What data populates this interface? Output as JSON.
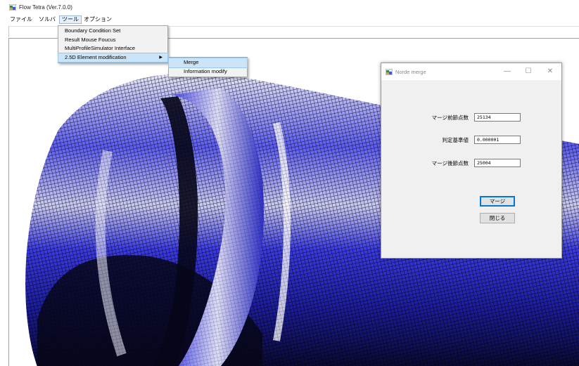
{
  "window": {
    "title": "Flow Tetra (Ver.7.0.0)",
    "icon": "app-icon"
  },
  "menubar": {
    "items": [
      {
        "label": "ファイル"
      },
      {
        "label": "ソルバ"
      },
      {
        "label": "ツール",
        "open": true
      },
      {
        "label": "オプション"
      }
    ]
  },
  "tools_menu": {
    "items": [
      {
        "label": "Boundary Condition Set"
      },
      {
        "label": "Result Mouse Foucus"
      },
      {
        "label": "MultiProfileSimulator Interface"
      },
      {
        "label": "2.5D Element modification",
        "submenu": true,
        "highlighted": true
      }
    ]
  },
  "submenu": {
    "items": [
      {
        "label": "Merge",
        "highlighted": true
      },
      {
        "label": "Information modify"
      }
    ]
  },
  "dialog": {
    "title": "Norde merge",
    "fields": [
      {
        "label": "マージ前節点数",
        "value": "25134"
      },
      {
        "label": "判定基準値",
        "value": "0.000001"
      },
      {
        "label": "マージ後節点数",
        "value": "25004"
      }
    ],
    "buttons": {
      "merge": "マージ",
      "close": "閉じる"
    },
    "controls": {
      "minimize": "—",
      "maximize": "☐",
      "close": "✕"
    }
  },
  "colors": {
    "mesh_blue": "#3a3ae0",
    "mesh_light": "#c9c9f2",
    "mesh_dark": "#07071a",
    "accent": "#0078d7",
    "menu_highlight": "#cce4f7"
  }
}
